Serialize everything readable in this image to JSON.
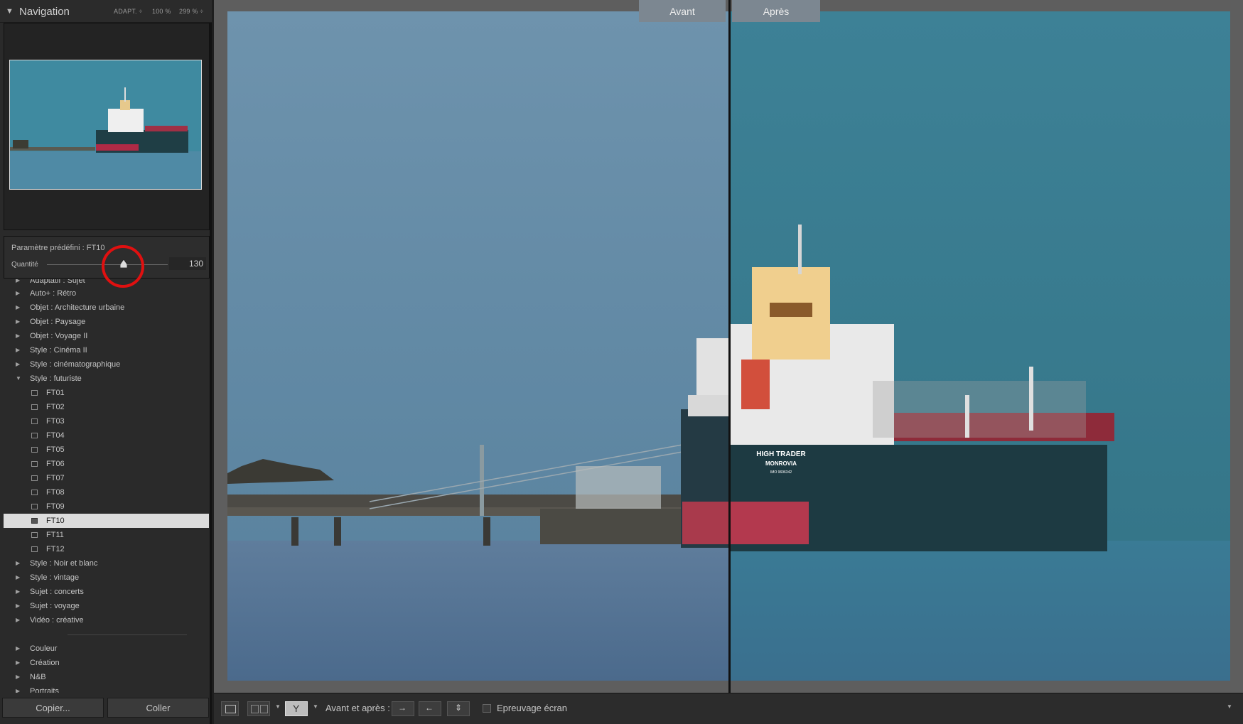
{
  "navigator": {
    "title": "Navigation",
    "zoom_fit": "ADAPT. ÷",
    "zoom_100": "100 %",
    "zoom_299": "299 % ÷"
  },
  "preset_amount": {
    "preset_label": "Paramètre prédéfini : FT10",
    "amount_label": "Quantité",
    "amount_value": "130",
    "amount_level": 0.65
  },
  "preset_tree": {
    "partial_top": "Adaptatif : Sujet",
    "groups_before": [
      {
        "label": "Auto+ : Rétro"
      },
      {
        "label": "Objet : Architecture urbaine"
      },
      {
        "label": "Objet : Paysage"
      },
      {
        "label": "Objet : Voyage II"
      },
      {
        "label": "Style : Cinéma II"
      },
      {
        "label": "Style : cinématographique"
      }
    ],
    "expanded_group": "Style : futuriste",
    "presets": [
      "FT01",
      "FT02",
      "FT03",
      "FT04",
      "FT05",
      "FT06",
      "FT07",
      "FT08",
      "FT09",
      "FT10",
      "FT11",
      "FT12"
    ],
    "selected_preset": "FT10",
    "groups_after": [
      {
        "label": "Style : Noir et blanc"
      },
      {
        "label": "Style : vintage"
      },
      {
        "label": "Sujet : concerts"
      },
      {
        "label": "Sujet : voyage"
      },
      {
        "label": "Vidéo : créative"
      }
    ],
    "groups_lower": [
      {
        "label": "Couleur"
      },
      {
        "label": "Création"
      },
      {
        "label": "N&B"
      },
      {
        "label": "Portraits"
      }
    ]
  },
  "panel_buttons": {
    "copy": "Copier...",
    "paste": "Coller"
  },
  "compare_view": {
    "before_label": "Avant",
    "after_label": "Après",
    "ship_name": "HIGH TRADER",
    "ship_port": "MONROVIA",
    "ship_imo": "IMO 9696342"
  },
  "toolbar": {
    "before_after_label": "Avant et après :",
    "softproof_label": "Epreuvage écran"
  },
  "icons": {
    "collapse": "triangle-down-icon",
    "expand": "triangle-right-icon",
    "preset": "preset-icon",
    "loupe": "loupe-view-icon",
    "compare": "before-after-icon",
    "split": "split-view-icon"
  },
  "colors": {
    "accent_highlight": "#e01010",
    "sky_before": "#6a8ea8",
    "sky_after": "#3a7a8f"
  }
}
